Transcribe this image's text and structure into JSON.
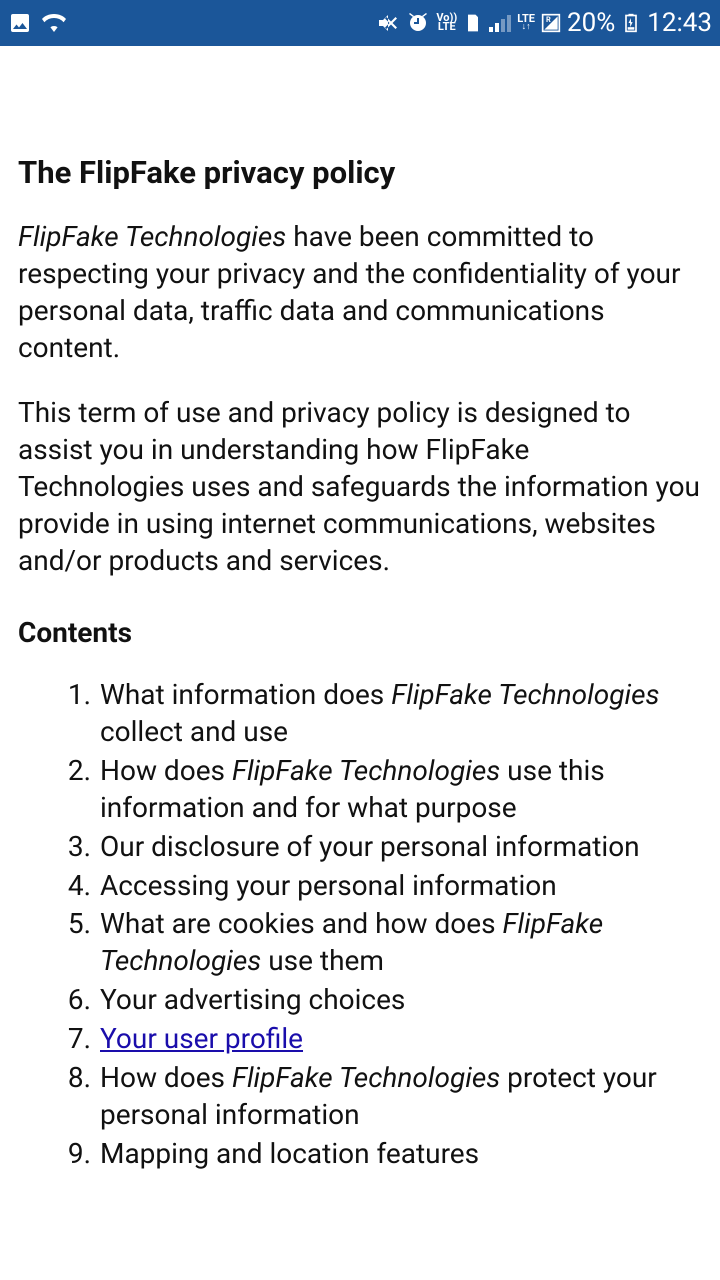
{
  "status": {
    "battery_pct": "20%",
    "time": "12:43",
    "lte_top": "LTE",
    "lte_bot": "LTE",
    "vo_top": "Vo))"
  },
  "doc": {
    "title": "The FlipFake privacy policy",
    "company_italic": "FlipFake Technologies",
    "para1_rest": " have been committed to respecting your privacy and the confidentiality of your personal data, traffic data and communications content.",
    "para2": "This term of use and privacy policy is designed to assist you in understanding how FlipFake Technologies uses and safeguards the information you provide in using internet communications, websites and/or products and services.",
    "contents_heading": "Contents",
    "toc": {
      "i1a": "What information does ",
      "i1b": "FlipFake Technologies",
      "i1c": " collect and use",
      "i2a": "How does ",
      "i2b": "FlipFake Technologies",
      "i2c": " use this information and for what purpose",
      "i3": "Our disclosure of your personal information",
      "i4": "Accessing your personal information",
      "i5a": "What are cookies and how does ",
      "i5b": "FlipFake Technologies",
      "i5c": " use them",
      "i6": "Your advertising choices",
      "i7": "Your user profile",
      "i8a": "How does ",
      "i8b": "FlipFake Technologies",
      "i8c": " protect your personal information",
      "i9": "Mapping and location features"
    }
  }
}
